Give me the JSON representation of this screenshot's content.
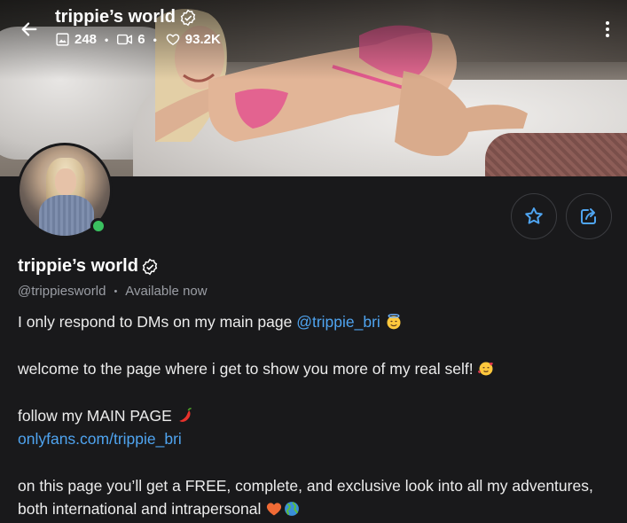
{
  "header": {
    "title": "trippie’s world",
    "stats": {
      "photos": "248",
      "videos": "6",
      "likes": "93.2K"
    }
  },
  "profile": {
    "name": "trippie’s world",
    "handle": "@trippiesworld",
    "status": "Available now"
  },
  "bio": {
    "line1_text": "I only respond to DMs on my main page ",
    "line1_mention": "@trippie_bri",
    "line2_text": "welcome to the page where i get to show you more of my real self!",
    "line3_text": "follow my MAIN PAGE",
    "line4_link": "onlyfans.com/trippie_bri",
    "line5_text": "on this page you’ll get a FREE, complete, and exclusive look into all my adventures,",
    "line6_text": "both international and intrapersonal"
  },
  "colors": {
    "accent": "#4fa4f0",
    "online": "#3ac160",
    "background": "#19191b"
  },
  "icons": [
    "back-arrow-icon",
    "image-icon",
    "video-icon",
    "heart-icon",
    "verified-icon",
    "more-vertical-icon",
    "star-icon",
    "share-icon"
  ]
}
